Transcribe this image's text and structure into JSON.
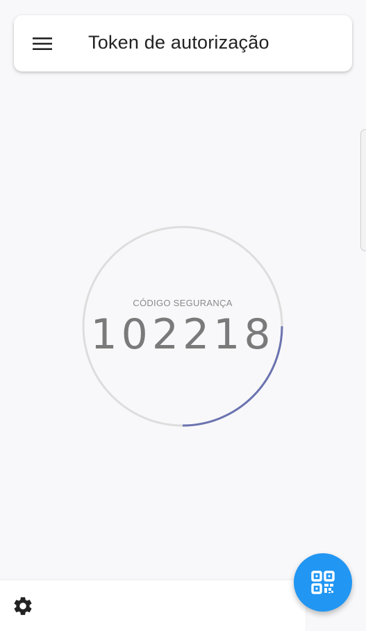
{
  "header": {
    "title": "Token de autorização",
    "menu_icon": "menu-icon"
  },
  "token": {
    "label": "CÓDIGO SEGURANÇA",
    "code": "102218",
    "progress_fraction": 0.25,
    "progress_color": "#6b73b0",
    "track_color": "#dddddd"
  },
  "bottom": {
    "settings_icon": "gear-icon",
    "fab_icon": "qr-code-icon",
    "fab_color": "#2196f3"
  }
}
